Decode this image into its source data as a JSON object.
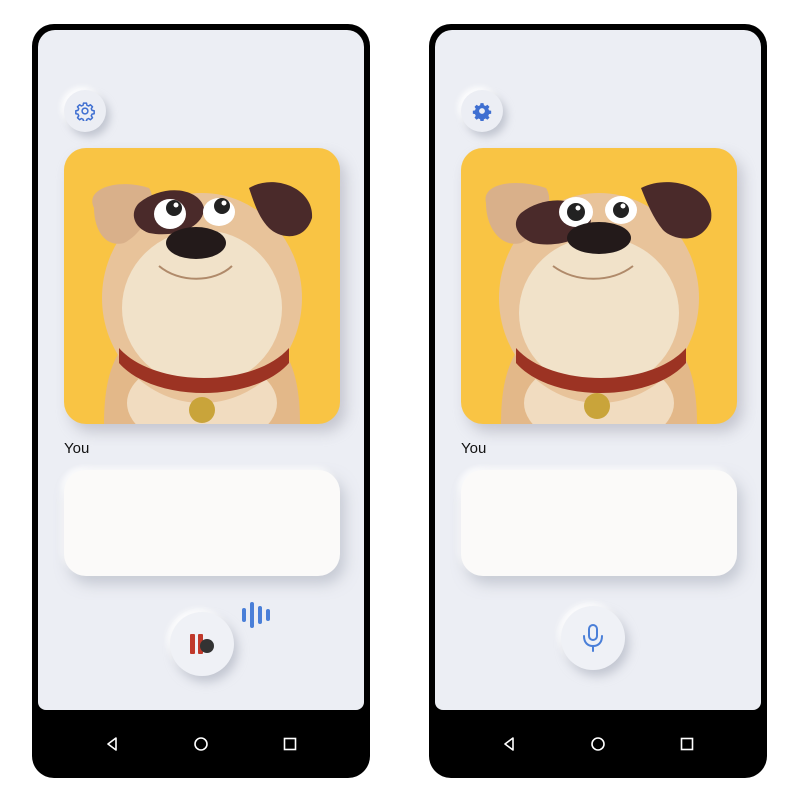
{
  "screens": [
    {
      "id": "listening",
      "speaker_label": "You",
      "transcript": "",
      "mic_state": "pause-icon",
      "show_sound_bars": true
    },
    {
      "id": "idle",
      "speaker_label": "You",
      "transcript": "",
      "mic_state": "microphone-icon",
      "show_sound_bars": false
    }
  ],
  "icons": {
    "settings": "gear-icon",
    "character": "cartoon-dog-avatar",
    "nav": [
      "back-triangle-icon",
      "home-circle-icon",
      "recents-square-icon"
    ]
  },
  "colors": {
    "background": "#eceef4",
    "card": "#f9c444",
    "accent_blue": "#4a7fd8",
    "pause_red": "#c0392b",
    "text": "#111111"
  }
}
